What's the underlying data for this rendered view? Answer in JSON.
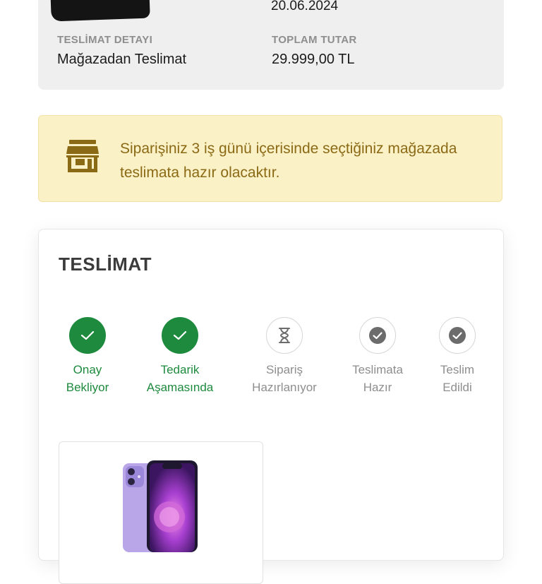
{
  "order_summary": {
    "partial_date": "20.06.2024",
    "delivery_label": "TESLİMAT DETAYI",
    "delivery_value": "Mağazadan Teslimat",
    "total_label": "TOPLAM TUTAR",
    "total_value": "29.999,00 TL"
  },
  "info_banner": {
    "icon": "store-icon",
    "text": "Siparişiniz 3 iş günü içerisinde seçtiğiniz mağazada teslimata hazır olacaktır."
  },
  "delivery": {
    "title": "TESLİMAT",
    "steps": [
      {
        "line1": "Onay",
        "line2": "Bekliyor",
        "status": "done",
        "icon": "check-icon"
      },
      {
        "line1": "Tedarik",
        "line2": "Aşamasında",
        "status": "done",
        "icon": "check-icon"
      },
      {
        "line1": "Sipariş",
        "line2": "Hazırlanıyor",
        "status": "pending",
        "icon": "hourglass-icon"
      },
      {
        "line1": "Teslimata",
        "line2": "Hazır",
        "status": "pending",
        "icon": "check-circle-icon"
      },
      {
        "line1": "Teslim",
        "line2": "Edildi",
        "status": "pending",
        "icon": "check-circle-icon"
      }
    ]
  },
  "colors": {
    "success": "#1e8a3e",
    "banner_bg": "#fbf1c6",
    "banner_text": "#8b6a16",
    "muted": "#8e8e8e"
  }
}
